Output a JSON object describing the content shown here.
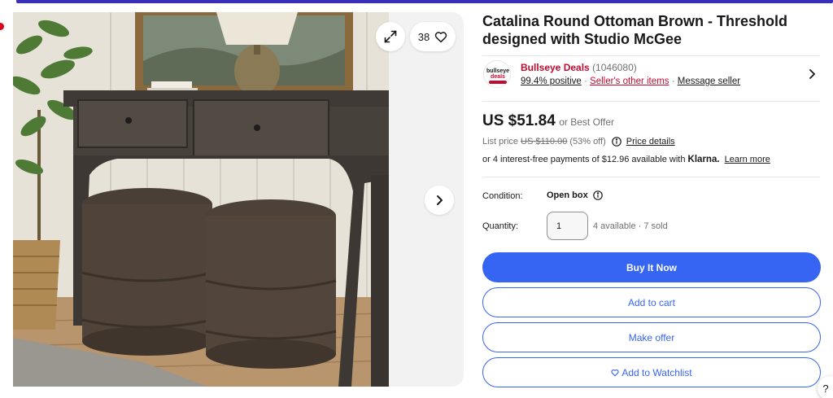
{
  "gallery": {
    "image_alt": "Two brown round upholstered ottomans tucked under a dark wood console table",
    "watch_count": "38",
    "icons": {
      "expand": "expand-icon",
      "heart": "heart-icon",
      "next": "chevron-right-icon"
    }
  },
  "listing": {
    "title": "Catalina Round Ottoman Brown - Threshold designed with Studio McGee"
  },
  "seller": {
    "logo_text": "bullseye deals",
    "name": "Bullseye Deals",
    "score": "(1046080)",
    "positive": "99.4% positive",
    "other_items": "Seller's other items",
    "message": "Message seller",
    "separator": "·"
  },
  "pricing": {
    "price": "US $51.84",
    "best_offer": "or Best Offer",
    "list_price_label": "List price",
    "list_price": "US $110.00",
    "discount": "(53% off)",
    "price_details": "Price details",
    "installments": "or 4 interest-free payments of $12.96 available with",
    "klarna": "Klarna.",
    "learn_more": "Learn more"
  },
  "condition": {
    "label": "Condition:",
    "value": "Open box"
  },
  "quantity": {
    "label": "Quantity:",
    "value": "1",
    "availability": "4 available · 7 sold"
  },
  "actions": {
    "buy_now": "Buy It Now",
    "add_to_cart": "Add to cart",
    "make_offer": "Make offer",
    "watchlist": "Add to Watchlist"
  },
  "help": {
    "label": "?"
  },
  "colors": {
    "accent_blue": "#3665f3",
    "seller_red": "#c40a2f",
    "text_primary": "#191919",
    "text_secondary": "#707070",
    "gallery_bg": "#f2f2f2"
  }
}
